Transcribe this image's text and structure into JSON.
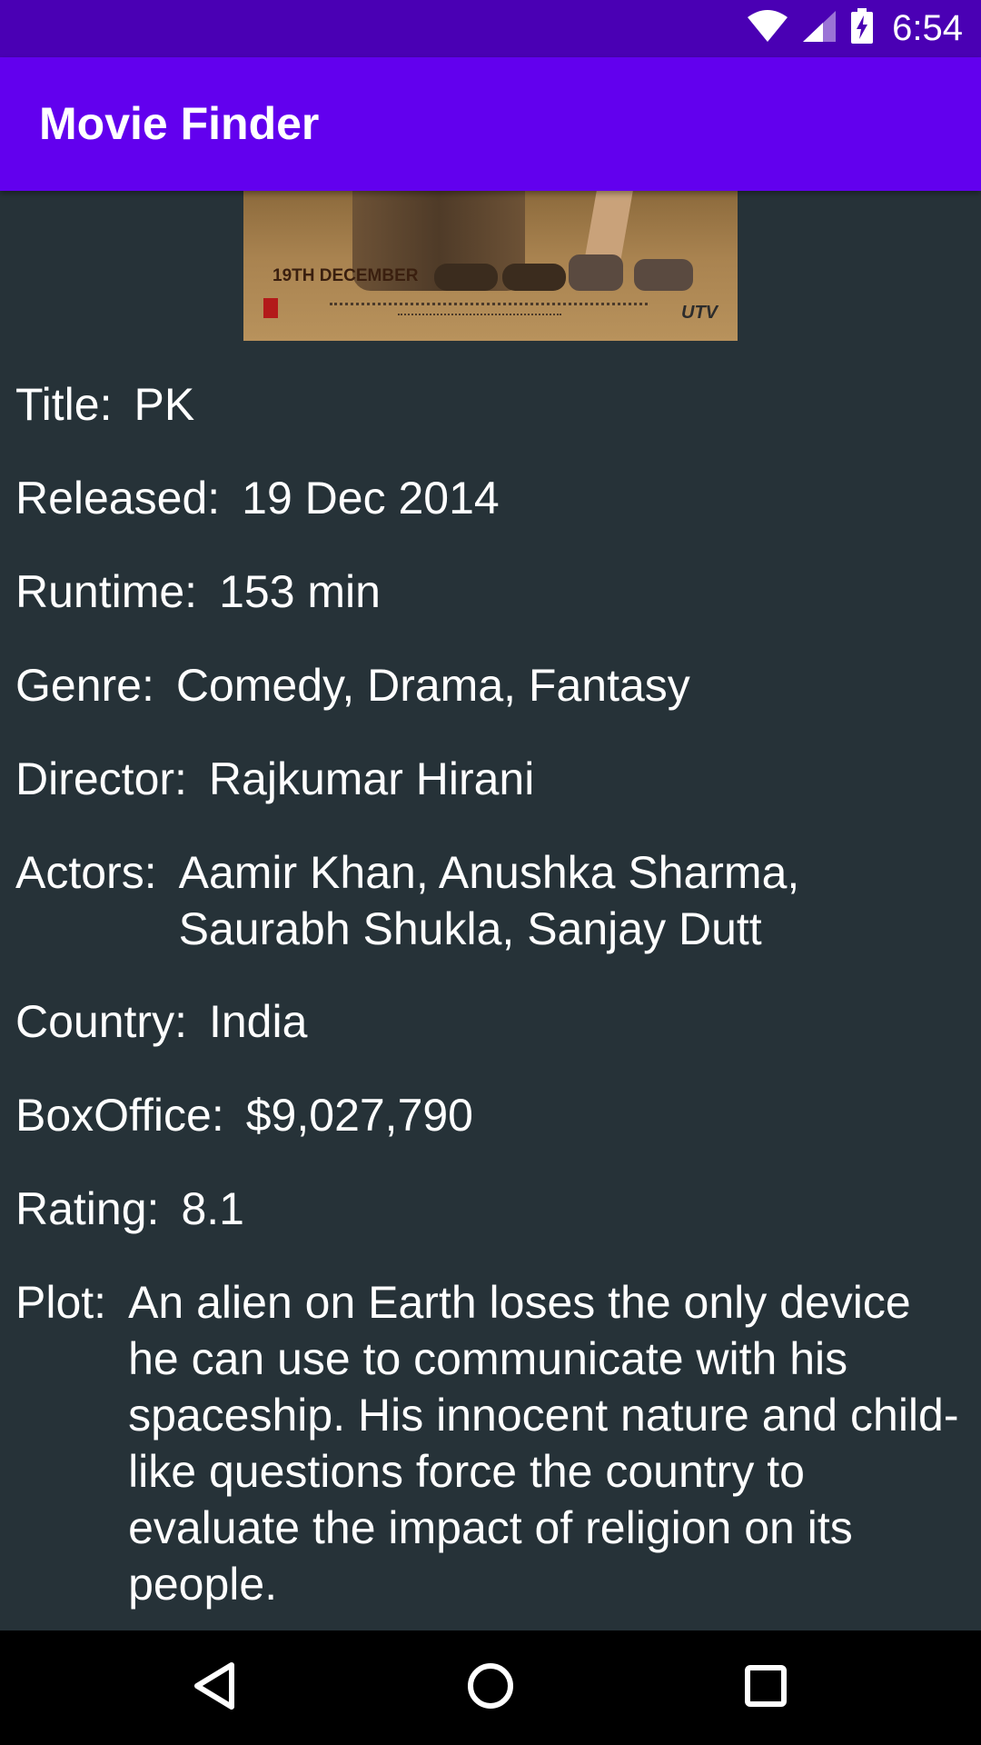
{
  "status_bar": {
    "time": "6:54",
    "icons": [
      "wifi-icon",
      "signal-icon",
      "battery-charging-icon"
    ]
  },
  "app_bar": {
    "title": "Movie Finder"
  },
  "poster": {
    "date_text": "19TH DECEMBER",
    "brand_text": "UTV"
  },
  "movie": {
    "fields": [
      {
        "label": "Title:",
        "value": "PK"
      },
      {
        "label": "Released:",
        "value": "19 Dec 2014"
      },
      {
        "label": "Runtime:",
        "value": "153 min"
      },
      {
        "label": "Genre:",
        "value": "Comedy, Drama, Fantasy"
      },
      {
        "label": "Director:",
        "value": "Rajkumar Hirani"
      },
      {
        "label": "Actors:",
        "value": "Aamir Khan, Anushka Sharma, Saurabh Shukla, Sanjay Dutt"
      },
      {
        "label": "Country:",
        "value": "India"
      },
      {
        "label": "BoxOffice:",
        "value": "$9,027,790"
      },
      {
        "label": "Rating:",
        "value": "8.1"
      },
      {
        "label": "Plot:",
        "value": "An alien on Earth loses the only device he can use to communicate with his spaceship. His innocent nature and child-like questions force the country to evaluate the impact of religion on its people."
      }
    ]
  },
  "nav_bar": {
    "icons": [
      "back-icon",
      "home-icon",
      "recents-icon"
    ]
  },
  "colors": {
    "status_bar": "#4a00b4",
    "app_bar": "#6200ee",
    "background": "#263238",
    "text": "#ffffff"
  }
}
